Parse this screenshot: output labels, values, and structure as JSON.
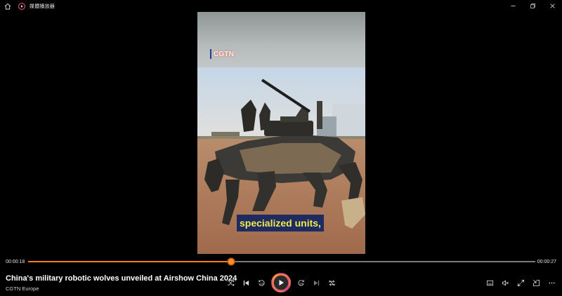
{
  "app": {
    "title": "媒體播放器"
  },
  "video": {
    "logo_text": "CGTN",
    "subtitle": "specialized units,"
  },
  "player": {
    "current_time": "00:00:18",
    "total_time": "00:00:27",
    "progress": 0.4,
    "media_title": "China's military robotic wolves unveiled at Airshow China 2024",
    "media_artist": "CGTN Europe"
  },
  "colors": {
    "accent": "#ff7b1c",
    "background": "#000000",
    "subtitle_bg": "#1e2a60",
    "subtitle_text": "#f1ea4e"
  },
  "icons": {
    "titlebar": [
      "home-icon",
      "media-player-logo-icon"
    ],
    "window": [
      "minimize-icon",
      "restore-icon",
      "close-icon"
    ],
    "transport": [
      "shuffle-icon",
      "previous-icon",
      "skip-back-10-icon",
      "play-icon",
      "skip-forward-30-icon",
      "next-icon",
      "repeat-off-icon"
    ],
    "extra": [
      "captions-icon",
      "volume-mute-icon",
      "fullscreen-icon",
      "mini-player-icon",
      "more-icon"
    ]
  }
}
